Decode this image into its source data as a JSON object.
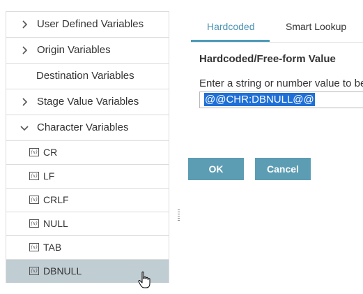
{
  "tree": {
    "groups": [
      {
        "label": "User Defined Variables",
        "icon": "chevron-right-icon"
      },
      {
        "label": "Origin Variables",
        "icon": "chevron-right-icon"
      },
      {
        "label": "Destination Variables",
        "icon": ""
      },
      {
        "label": "Stage Value Variables",
        "icon": "chevron-right-icon"
      },
      {
        "label": "Character Variables",
        "icon": "chevron-down-icon"
      }
    ],
    "items": [
      {
        "label": "CR",
        "icon": "variable-icon",
        "icon_text": "(x)"
      },
      {
        "label": "LF",
        "icon": "variable-icon",
        "icon_text": "(x)"
      },
      {
        "label": "CRLF",
        "icon": "variable-icon",
        "icon_text": "(x)"
      },
      {
        "label": "NULL",
        "icon": "variable-icon",
        "icon_text": "(x)"
      },
      {
        "label": "TAB",
        "icon": "variable-icon",
        "icon_text": "(x)"
      },
      {
        "label": "DBNULL",
        "icon": "variable-icon",
        "icon_text": "(x)",
        "selected": true
      }
    ]
  },
  "tabs": [
    {
      "label": "Hardcoded",
      "active": true
    },
    {
      "label": "Smart Lookup",
      "active": false
    }
  ],
  "editor": {
    "title": "Hardcoded/Free-form Value",
    "prompt": "Enter a string or number value to be",
    "value": "@@CHR:DBNULL@@"
  },
  "buttons": {
    "ok": "OK",
    "cancel": "Cancel"
  },
  "colors": {
    "accent": "#4e9ab7",
    "button": "#5c9db3",
    "selected_row": "#c0cdd3",
    "selection_highlight": "#1f6fd6"
  }
}
